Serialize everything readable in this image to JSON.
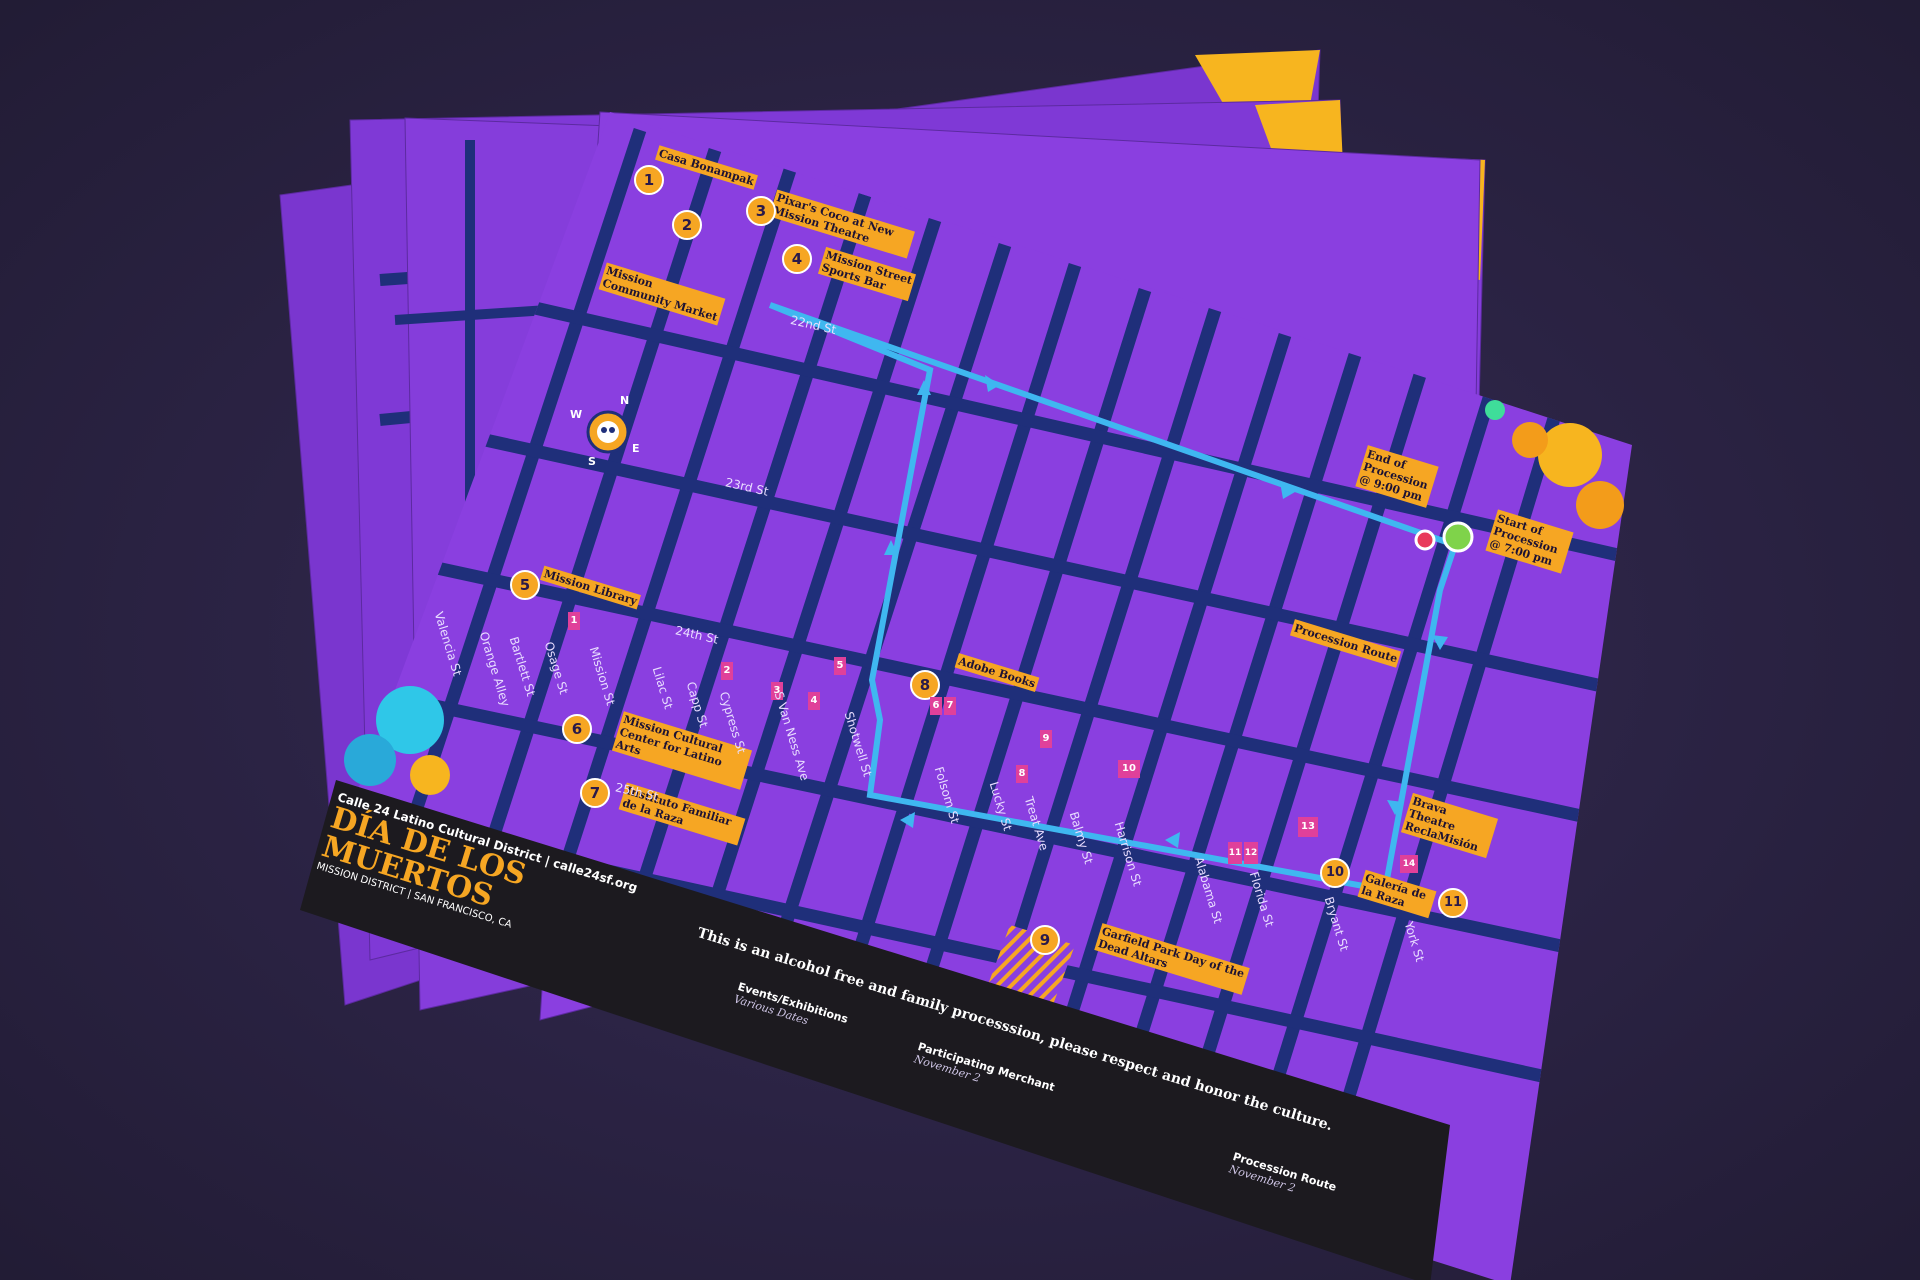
{
  "map": {
    "district_line": "Calle 24 Latino Cultural District | calle24sf.org",
    "title_line1": "DÍA DE LOS",
    "title_line2": "MUERTOS",
    "location": "MISSION DISTRICT | SAN FRANCISCO, CA",
    "notice": "This is an alcohol free and family processsion, please respect and honor the culture.",
    "compass": [
      "N",
      "S",
      "E",
      "W"
    ],
    "streets_horizontal": [
      "22nd St",
      "23rd St",
      "24th St",
      "25th St"
    ],
    "streets_vertical": [
      "Valencia St",
      "Orange Alley",
      "Bartlett St",
      "Osage St",
      "Mission St",
      "Lilac St",
      "Capp St",
      "Cypress St",
      "S Van Ness Ave",
      "Shotwell St",
      "Folsom St",
      "Lucky St",
      "Treat Ave",
      "Balmy St",
      "Harrison St",
      "Alabama St",
      "Florida St",
      "Bryant St",
      "York St"
    ],
    "places": [
      {
        "num": "1",
        "label": "Casa Bonampak"
      },
      {
        "num": "2",
        "label": "Mission Community Market"
      },
      {
        "num": "3",
        "label": "Pixar's Coco at New Mission Theatre"
      },
      {
        "num": "4",
        "label": "Mission Street Sports Bar"
      },
      {
        "num": "5",
        "label": "Mission Library"
      },
      {
        "num": "6",
        "label": "Mission Cultural Center for Latino Arts"
      },
      {
        "num": "7",
        "label": "Instituto Familiar de la Raza"
      },
      {
        "num": "8",
        "label": "Adobe Books"
      },
      {
        "num": "9",
        "label": "Garfield Park Day of the Dead Altars"
      },
      {
        "num": "10",
        "label": "Galería de la Raza"
      },
      {
        "num": "11",
        "label": "Brava Theatre ReclaMisión"
      }
    ],
    "merchants": [
      "1",
      "2",
      "3",
      "4",
      "5",
      "6",
      "7",
      "8",
      "9",
      "10",
      "11",
      "12",
      "13",
      "14"
    ],
    "procession": {
      "end_label": "End of Procession @ 9:00 pm",
      "start_label": "Start of Procession @ 7:00 pm",
      "route_label": "Procession Route"
    },
    "legend": {
      "events_title": "Events/Exhibitions",
      "events_sub": "Various Dates",
      "merchant_title": "Participating Merchant",
      "merchant_sub": "November 2",
      "route_title": "Procession Route",
      "route_sub": "November 2"
    },
    "colors": {
      "background": "#2a2340",
      "map_purple": "#8a3fe0",
      "street_navy": "#1f2f7a",
      "route_blue": "#3fb7f0",
      "label_orange": "#f6a623",
      "merchant_pink": "#e0409a",
      "banner_black": "#1c1a1f",
      "start_green": "#7fd34a",
      "end_red": "#e83a5c",
      "marigold": "#f7b51f"
    }
  }
}
